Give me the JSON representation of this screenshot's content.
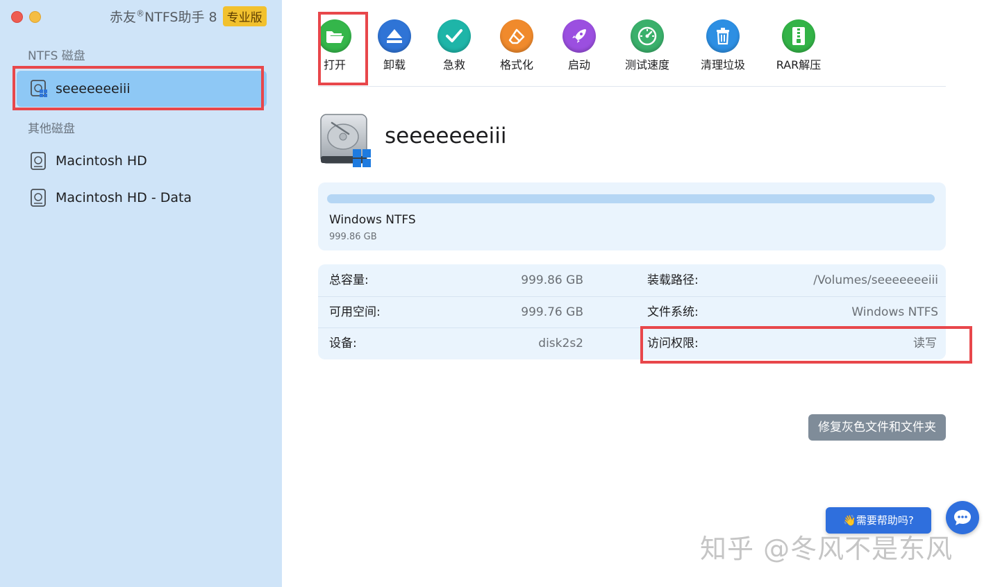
{
  "window": {
    "title_prefix": "赤友",
    "title_registered": "®",
    "title_suffix": "NTFS助手 8",
    "edition_badge": "专业版"
  },
  "sidebar": {
    "ntfs_section": "NTFS 磁盘",
    "ntfs_disks": [
      {
        "label": "seeeeeeeiii",
        "icon": "windows-disk-icon",
        "selected": true
      }
    ],
    "other_section": "其他磁盘",
    "other_disks": [
      {
        "label": "Macintosh HD",
        "icon": "disk-icon"
      },
      {
        "label": "Macintosh HD - Data",
        "icon": "disk-icon"
      }
    ]
  },
  "toolbar": {
    "items": [
      {
        "label": "打开",
        "icon": "folder-open-icon",
        "color": "#34b64a"
      },
      {
        "label": "卸载",
        "icon": "eject-icon",
        "color": "#2f74d6"
      },
      {
        "label": "急救",
        "icon": "checkmark-icon",
        "color": "#1eb5a8"
      },
      {
        "label": "格式化",
        "icon": "eraser-icon",
        "color": "#f08a2c"
      },
      {
        "label": "启动",
        "icon": "rocket-icon",
        "color": "#9b4fe0"
      },
      {
        "label": "测试速度",
        "icon": "speedometer-icon",
        "color": "#3ab06b"
      },
      {
        "label": "清理垃圾",
        "icon": "trash-icon",
        "color": "#2d8fe3"
      },
      {
        "label": "RAR解压",
        "icon": "archive-icon",
        "color": "#33b347"
      }
    ]
  },
  "disk": {
    "name": "seeeeeeeiii",
    "icon": "windows-hard-drive-icon",
    "partition": {
      "filesystem": "Windows NTFS",
      "size": "999.86 GB"
    }
  },
  "info": {
    "total_label": "总容量:",
    "total_value": "999.86 GB",
    "free_label": "可用空间:",
    "free_value": "999.76 GB",
    "device_label": "设备:",
    "device_value": "disk2s2",
    "mount_label": "装载路径:",
    "mount_value": "/Volumes/seeeeeeeiii",
    "fs_label": "文件系统:",
    "fs_value": "Windows NTFS",
    "access_label": "访问权限:",
    "access_value": "读写"
  },
  "actions": {
    "repair_label": "修复灰色文件和文件夹",
    "help_label": "👋需要帮助吗?",
    "chat_icon": "chat-bubble-icon"
  },
  "watermark": "知乎 @冬风不是东风",
  "colors": {
    "sidebar_bg": "#cfe4f8",
    "selected_bg": "#8ec8f5",
    "highlight_red": "#e8474b",
    "card_bg": "#eaf4fd",
    "accent_blue": "#2f6fdd"
  }
}
